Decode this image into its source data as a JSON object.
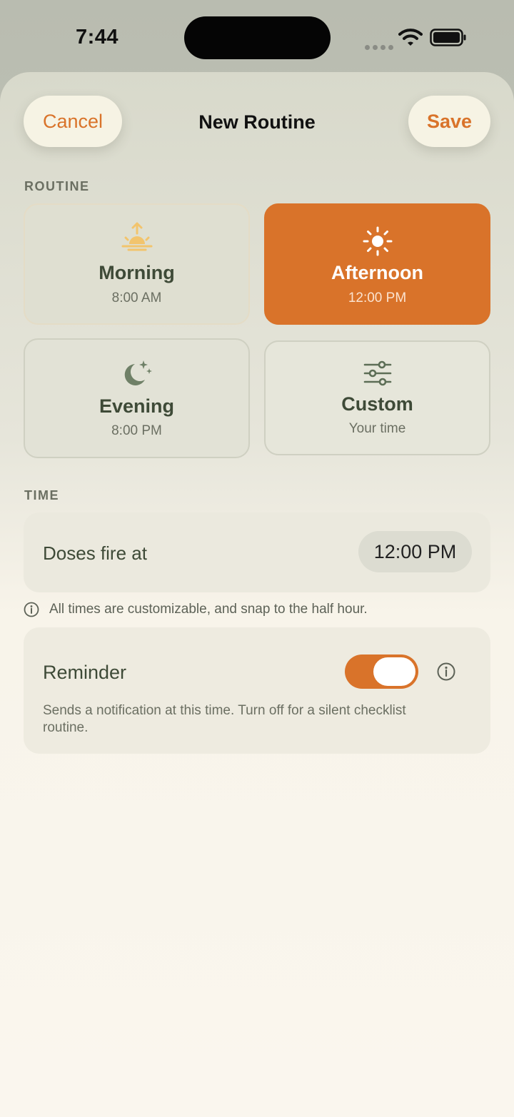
{
  "status_bar": {
    "time": "7:44"
  },
  "header": {
    "cancel_label": "Cancel",
    "title": "New Routine",
    "save_label": "Save"
  },
  "routine_section": {
    "label": "ROUTINE",
    "options": [
      {
        "title": "Morning",
        "subtitle": "8:00 AM",
        "icon": "sunrise-icon",
        "selected": false
      },
      {
        "title": "Afternoon",
        "subtitle": "12:00 PM",
        "icon": "sun-icon",
        "selected": true
      },
      {
        "title": "Evening",
        "subtitle": "8:00 PM",
        "icon": "moon-stars-icon",
        "selected": false
      },
      {
        "title": "Custom",
        "subtitle": "Your time",
        "icon": "sliders-icon",
        "selected": false
      }
    ]
  },
  "time_section": {
    "label": "TIME",
    "field_label": "Doses fire at",
    "value": "12:00 PM",
    "hint": "All times are customizable, and snap to the half hour."
  },
  "reminder": {
    "label": "Reminder",
    "enabled": true,
    "description": "Sends a notification at this time. Turn off for a silent checklist routine."
  },
  "colors": {
    "accent": "#d9732a",
    "text_green": "#3e4a37",
    "muted": "#6b6f62"
  }
}
